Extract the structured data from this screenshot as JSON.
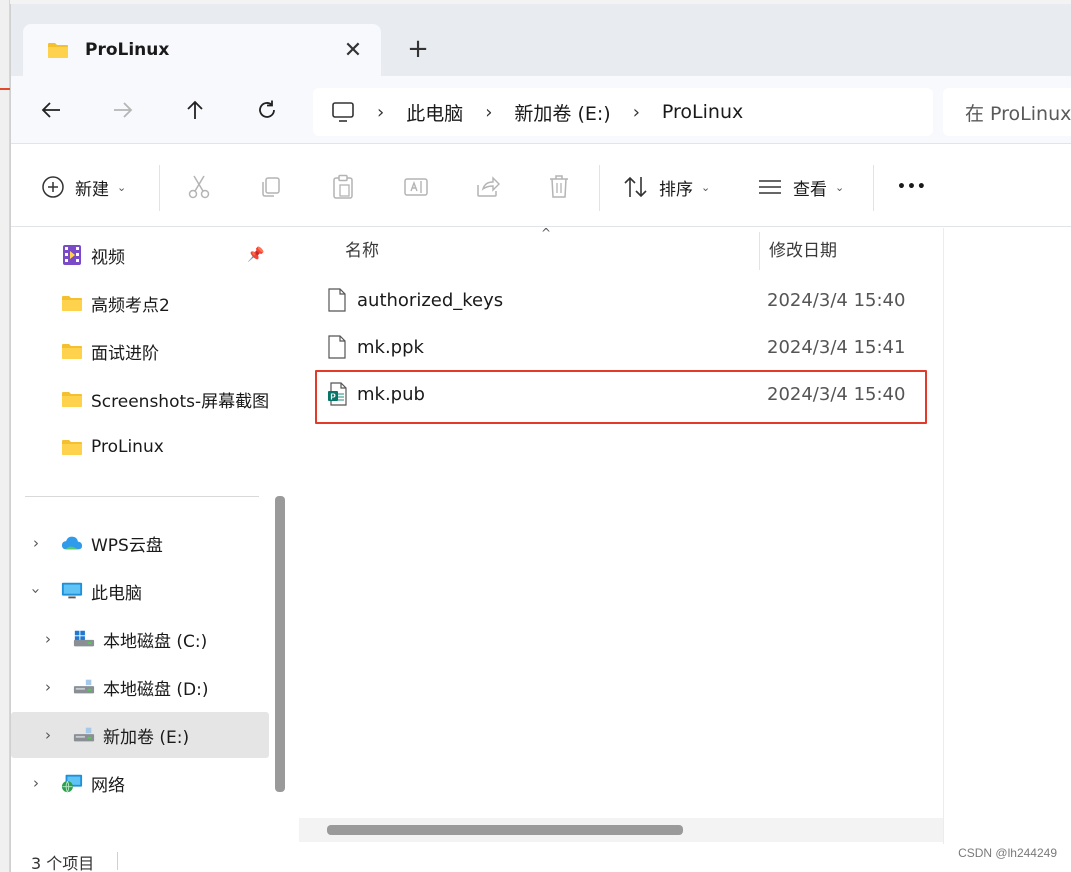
{
  "window": {
    "tab_title": "ProLinux",
    "tab_close": "✕",
    "new_tab": "+"
  },
  "address": {
    "segments": [
      "此电脑",
      "新加卷 (E:)",
      "ProLinux"
    ],
    "search_placeholder": "在 ProLinux"
  },
  "commands": {
    "new_label": "新建",
    "sort_label": "排序",
    "view_label": "查看",
    "more": "•••"
  },
  "sidebar": {
    "quick_access": [
      {
        "label": "视频",
        "icon": "video-folder-icon",
        "pinned": true
      },
      {
        "label": "高频考点2",
        "icon": "folder-icon"
      },
      {
        "label": "面试进阶",
        "icon": "folder-icon"
      },
      {
        "label": "Screenshots-屏幕截图",
        "icon": "folder-icon"
      },
      {
        "label": "ProLinux",
        "icon": "folder-icon"
      }
    ],
    "tree": [
      {
        "label": "WPS云盘",
        "icon": "cloud-icon",
        "expanded": false
      },
      {
        "label": "此电脑",
        "icon": "computer-icon",
        "expanded": true
      },
      {
        "label": "本地磁盘 (C:)",
        "icon": "windows-drive-icon",
        "expanded": false
      },
      {
        "label": "本地磁盘 (D:)",
        "icon": "drive-icon",
        "expanded": false
      },
      {
        "label": "新加卷 (E:)",
        "icon": "drive-icon",
        "expanded": false,
        "selected": true
      },
      {
        "label": "网络",
        "icon": "network-icon",
        "expanded": false
      }
    ]
  },
  "filelist": {
    "columns": [
      "名称",
      "修改日期"
    ],
    "files": [
      {
        "name": "authorized_keys",
        "modified": "2024/3/4 15:40",
        "icon": "blank-file-icon"
      },
      {
        "name": "mk.ppk",
        "modified": "2024/3/4 15:41",
        "icon": "blank-file-icon"
      },
      {
        "name": "mk.pub",
        "modified": "2024/3/4 15:40",
        "icon": "publisher-file-icon",
        "highlighted": true
      }
    ]
  },
  "status": {
    "item_count": "3 个项目"
  },
  "watermark": "CSDN @lh244249",
  "colors": {
    "highlight_border": "#e23b2a",
    "folder_yellow": "#f4c030",
    "selection_bg": "#e5e5e5"
  }
}
